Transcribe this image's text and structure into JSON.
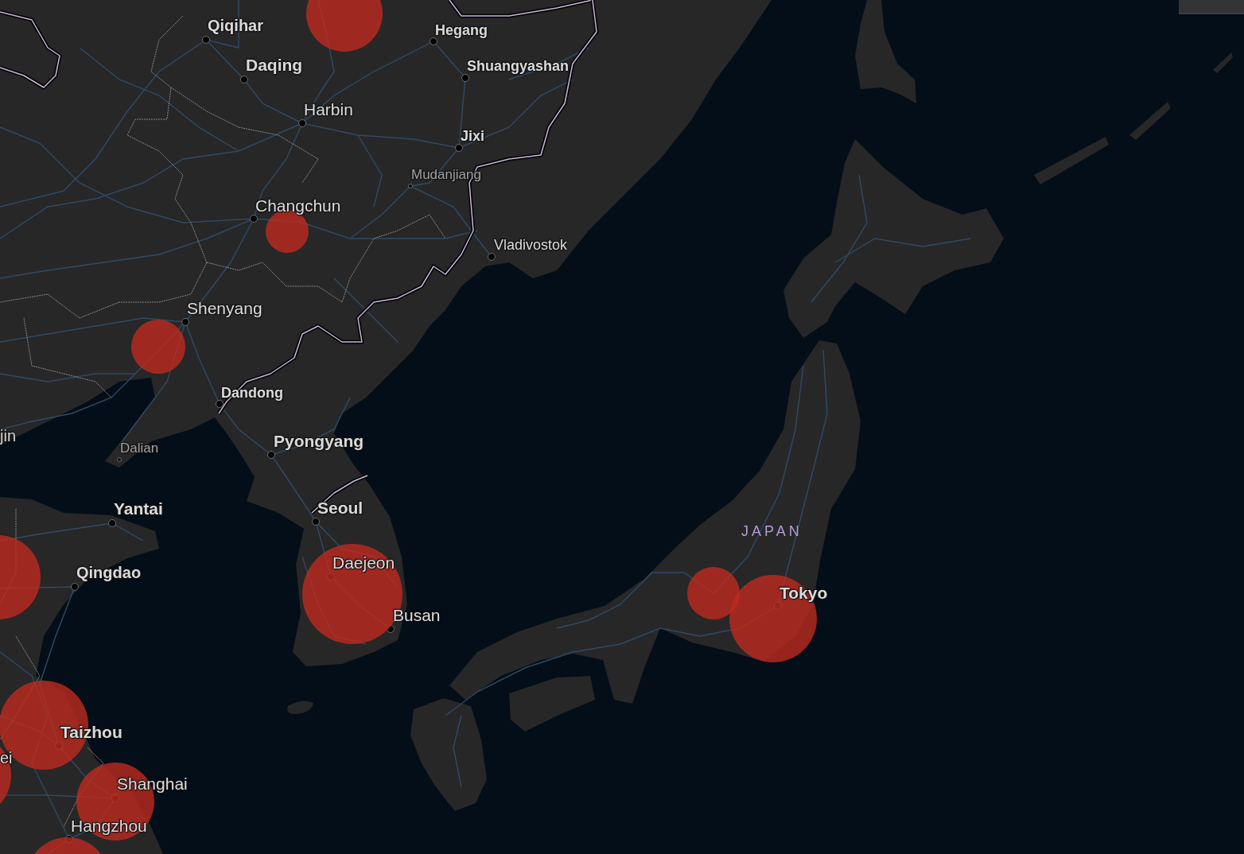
{
  "map": {
    "cities": [
      {
        "name": "Qiqihar",
        "kind": "major"
      },
      {
        "name": "Daqing",
        "kind": "major"
      },
      {
        "name": "Hegang",
        "kind": "major"
      },
      {
        "name": "Shuangyashan",
        "kind": "major"
      },
      {
        "name": "Harbin",
        "kind": "city"
      },
      {
        "name": "Jixi",
        "kind": "major"
      },
      {
        "name": "Mudanjiang",
        "kind": "town"
      },
      {
        "name": "Changchun",
        "kind": "city"
      },
      {
        "name": "Vladivostok",
        "kind": "city"
      },
      {
        "name": "Shenyang",
        "kind": "city"
      },
      {
        "name": "Dandong",
        "kind": "major"
      },
      {
        "name": "jin",
        "kind": "cut"
      },
      {
        "name": "Dalian",
        "kind": "town"
      },
      {
        "name": "Pyongyang",
        "kind": "major"
      },
      {
        "name": "Yantai",
        "kind": "major"
      },
      {
        "name": "Seoul",
        "kind": "major"
      },
      {
        "name": "Qingdao",
        "kind": "major"
      },
      {
        "name": "Daejeon",
        "kind": "city"
      },
      {
        "name": "Busan",
        "kind": "city"
      },
      {
        "name": "Taizhou",
        "kind": "major"
      },
      {
        "name": "ei",
        "kind": "cut"
      },
      {
        "name": "Shanghai",
        "kind": "city"
      },
      {
        "name": "Hangzhou",
        "kind": "city"
      },
      {
        "name": "Tokyo",
        "kind": "major"
      }
    ],
    "country_labels": [
      {
        "name": "JAPAN"
      }
    ]
  }
}
